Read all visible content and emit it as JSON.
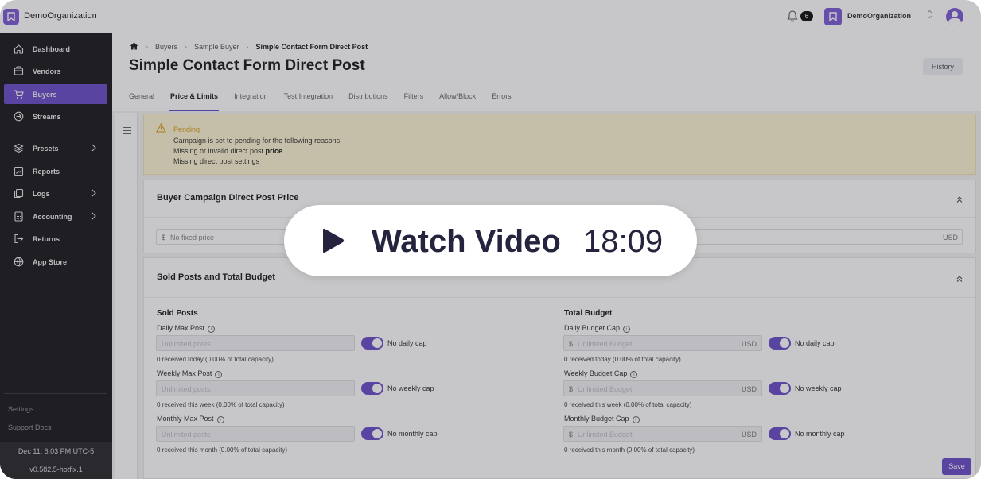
{
  "topbar": {
    "org_name": "DemoOrganization",
    "notification_count": "6",
    "org_selector_name": "DemoOrganization"
  },
  "sidebar": {
    "items": [
      {
        "label": "Dashboard",
        "icon": "home-icon"
      },
      {
        "label": "Vendors",
        "icon": "database-icon"
      },
      {
        "label": "Buyers",
        "icon": "cart-icon",
        "active": true
      },
      {
        "label": "Streams",
        "icon": "arrow-circle-icon"
      },
      {
        "label": "Presets",
        "icon": "layers-icon",
        "has_children": true
      },
      {
        "label": "Reports",
        "icon": "chart-icon"
      },
      {
        "label": "Logs",
        "icon": "copy-icon",
        "has_children": true
      },
      {
        "label": "Accounting",
        "icon": "calculator-icon",
        "has_children": true
      },
      {
        "label": "Returns",
        "icon": "return-icon"
      },
      {
        "label": "App Store",
        "icon": "globe-icon"
      }
    ],
    "settings_label": "Settings",
    "support_label": "Support Docs",
    "timestamp": "Dec 11, 6:03 PM UTC-5",
    "version": "v0.582.5-hotfix.1"
  },
  "breadcrumb": {
    "items": [
      "Buyers",
      "Sample Buyer"
    ],
    "current": "Simple Contact Form Direct Post"
  },
  "page": {
    "title": "Simple Contact Form Direct Post",
    "history_label": "History"
  },
  "tabs": [
    {
      "label": "General"
    },
    {
      "label": "Price & Limits",
      "active": true
    },
    {
      "label": "Integration"
    },
    {
      "label": "Test Integration"
    },
    {
      "label": "Distributions"
    },
    {
      "label": "Filters"
    },
    {
      "label": "Allow/Block"
    },
    {
      "label": "Errors"
    }
  ],
  "alert": {
    "title": "Pending",
    "line1": "Campaign is set to pending for the following reasons:",
    "line2_prefix": "Missing or invalid direct post ",
    "line2_bold": "price",
    "line3": "Missing direct post settings"
  },
  "price_card": {
    "title": "Buyer Campaign Direct Post Price",
    "currency_symbol": "$",
    "placeholder": "No fixed price",
    "currency_code": "USD"
  },
  "budget_card": {
    "title": "Sold Posts and Total Budget",
    "sold_posts": {
      "heading": "Sold Posts",
      "fields": [
        {
          "label": "Daily Max Post",
          "placeholder": "Unlimited posts",
          "toggle_label": "No daily cap",
          "help": "0 received today (0.00% of total capacity)"
        },
        {
          "label": "Weekly Max Post",
          "placeholder": "Unlimited posts",
          "toggle_label": "No weekly cap",
          "help": "0 received this week (0.00% of total capacity)"
        },
        {
          "label": "Monthly Max Post",
          "placeholder": "Unlimited posts",
          "toggle_label": "No monthly cap",
          "help": "0 received this month (0.00% of total capacity)"
        }
      ]
    },
    "total_budget": {
      "heading": "Total Budget",
      "currency_symbol": "$",
      "currency_code": "USD",
      "fields": [
        {
          "label": "Daily Budget Cap",
          "placeholder": "Unlimited Budget",
          "toggle_label": "No daily cap",
          "help": "0 received today (0.00% of total capacity)"
        },
        {
          "label": "Weekly Budget Cap",
          "placeholder": "Unlimited Budget",
          "toggle_label": "No weekly cap",
          "help": "0 received this week (0.00% of total capacity)"
        },
        {
          "label": "Monthly Budget Cap",
          "placeholder": "Unlimited Budget",
          "toggle_label": "No monthly cap",
          "help": "0 received this month (0.00% of total capacity)"
        }
      ]
    }
  },
  "save_label": "Save",
  "video": {
    "label": "Watch Video",
    "duration": "18:09"
  },
  "colors": {
    "accent": "#6b4fc9",
    "sidebar_bg": "#1c1c1f",
    "alert_bg": "#fdf4d4",
    "alert_text": "#d89a14"
  }
}
